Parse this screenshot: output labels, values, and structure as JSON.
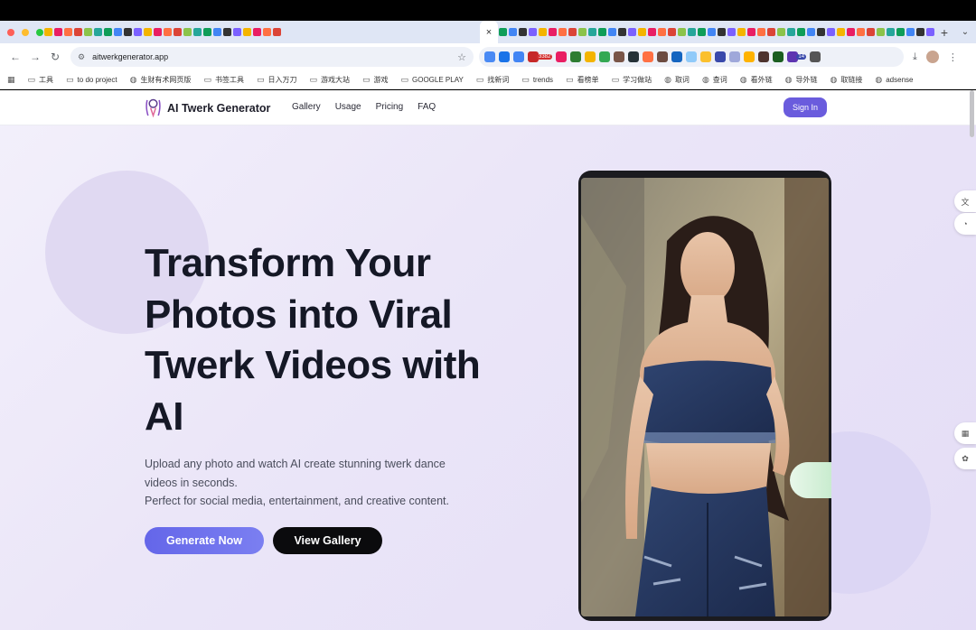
{
  "browser": {
    "active_tab_close": "×",
    "new_tab": "+",
    "tab_menu": "⌄",
    "url": "aitwerkgenerator.app",
    "ext_badge_1": "3382",
    "ext_badge_2": "14",
    "colors": {
      "tabstrip": "#dfe6f5",
      "omnibox": "#eef1f8"
    }
  },
  "bookmarks": [
    {
      "label": "工具",
      "icon": "folder-icon"
    },
    {
      "label": "to do project",
      "icon": "folder-icon"
    },
    {
      "label": "生财有术网页版",
      "icon": "globe-icon"
    },
    {
      "label": "书签工具",
      "icon": "folder-icon"
    },
    {
      "label": "日入万刀",
      "icon": "folder-icon"
    },
    {
      "label": "游戏大站",
      "icon": "folder-icon"
    },
    {
      "label": "游戏",
      "icon": "folder-icon"
    },
    {
      "label": "GOOGLE PLAY",
      "icon": "folder-icon"
    },
    {
      "label": "找新词",
      "icon": "folder-icon"
    },
    {
      "label": "trends",
      "icon": "folder-icon"
    },
    {
      "label": "看榜单",
      "icon": "folder-icon"
    },
    {
      "label": "学习做站",
      "icon": "folder-icon"
    },
    {
      "label": "取词",
      "icon": "globe-icon"
    },
    {
      "label": "查词",
      "icon": "globe-icon"
    },
    {
      "label": "看外链",
      "icon": "globe-icon"
    },
    {
      "label": "导外链",
      "icon": "globe-icon"
    },
    {
      "label": "取链接",
      "icon": "globe-icon"
    },
    {
      "label": "adsense",
      "icon": "globe-icon"
    }
  ],
  "site": {
    "brand": "AI Twerk Generator",
    "nav": [
      "Gallery",
      "Usage",
      "Pricing",
      "FAQ"
    ],
    "signin": "Sign In",
    "accent": "#6a5cdd"
  },
  "hero": {
    "title": "Transform Your Photos into Viral Twerk Videos with AI",
    "subtitle_line1": "Upload any photo and watch AI create stunning twerk dance videos in seconds.",
    "subtitle_line2": "Perfect for social media, entertainment, and creative content.",
    "cta_primary": "Generate Now",
    "cta_secondary": "View Gallery"
  }
}
